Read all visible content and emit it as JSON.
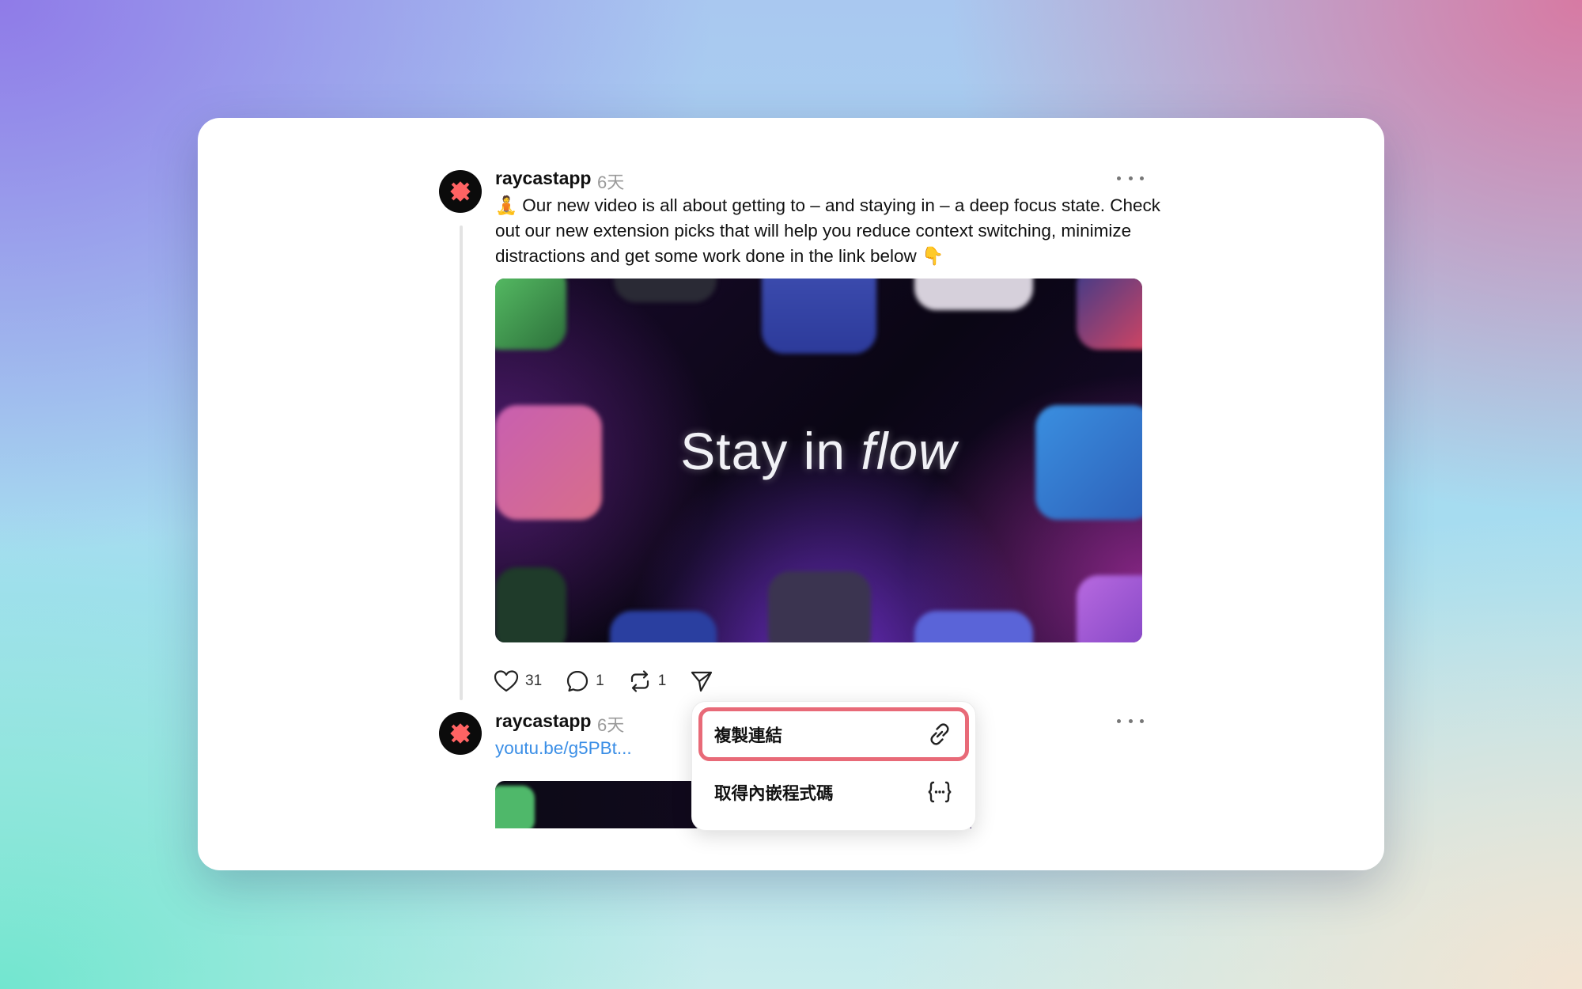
{
  "post": {
    "username": "raycastapp",
    "time": "6天",
    "text": "🧘 Our new video is all about getting to – and staying in – a deep focus state. Check out our new extension picks that will help you reduce context switching, minimize distractions and get some work done in the link below 👇",
    "media_title_main": "Stay in ",
    "media_title_em": "flow",
    "likes": "31",
    "replies": "1",
    "reposts": "1"
  },
  "reply": {
    "username": "raycastapp",
    "time": "6天",
    "link_text": "youtu.be/g5PBt..."
  },
  "menu": {
    "copy_link": "複製連結",
    "get_embed": "取得內嵌程式碼"
  },
  "icons": {
    "more": "more-horizontal-icon",
    "like": "heart-icon",
    "reply": "comment-icon",
    "repost": "repost-icon",
    "share": "send-icon",
    "link": "link-icon",
    "embed": "code-braces-icon"
  },
  "colors": {
    "accent_highlight": "#e86a78",
    "link": "#3a8ee6",
    "avatar_bg": "#0b0b0b",
    "brand": "#ff6363"
  }
}
